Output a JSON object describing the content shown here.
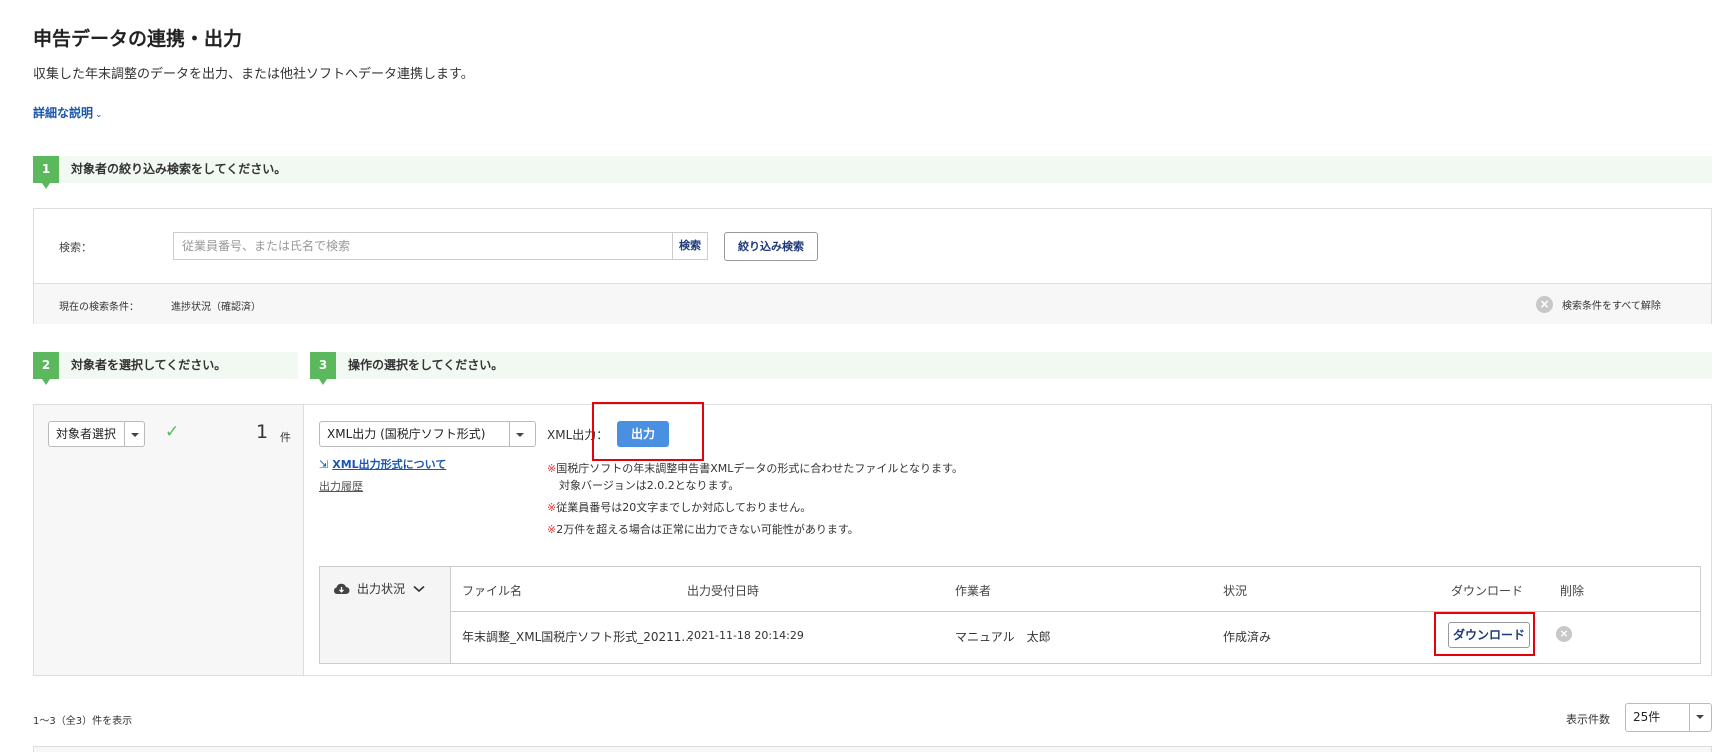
{
  "header": {
    "title": "申告データの連携・出力",
    "description": "収集した年末調整のデータを出力、または他社ソフトへデータ連携します。",
    "detail_link": "詳細な説明",
    "detail_chevron": "⌄"
  },
  "step1": {
    "number": "1",
    "label": "対象者の絞り込み検索をしてください。",
    "search_label": "検索：",
    "search_placeholder": "従業員番号、または氏名で検索",
    "search_button": "検索",
    "filter_button": "絞り込み検索",
    "current_condition_label": "現在の検索条件：",
    "current_condition_value": "進捗状況（確認済）",
    "clear_all": "検索条件をすべて解除"
  },
  "step2": {
    "number": "2",
    "label": "対象者を選択してください。",
    "select_dropdown": "対象者選択",
    "check_mark": "✓",
    "count": "1",
    "count_unit": "件"
  },
  "step3": {
    "number": "3",
    "label": "操作の選択をしてください。",
    "format_dropdown": "XML出力 (国税庁ソフト形式)",
    "output_label": "XML出力：",
    "output_button": "出力",
    "format_link_icon": "⇲",
    "format_link": "XML出力形式について",
    "history_link": "出力履歴",
    "notes": [
      {
        "mark": "※",
        "text": "国税庁ソフトの年末調整申告書XMLデータの形式に合わせたファイルとなります。"
      },
      {
        "mark": "",
        "text": "対象バージョンは2.0.2となります。"
      },
      {
        "mark": "※",
        "text": "従業員番号は20文字までしか対応しておりません。"
      },
      {
        "mark": "※",
        "text": "2万件を超える場合は正常に出力できない可能性があります。"
      }
    ]
  },
  "output_table": {
    "status_toggle": "出力状況",
    "columns": {
      "filename": "ファイル名",
      "received": "出力受付日時",
      "operator": "作業者",
      "status": "状況",
      "download": "ダウンロード",
      "delete": "削除"
    },
    "rows": [
      {
        "filename": "年末調整_XML国税庁ソフト形式_20211...",
        "received": "2021-11-18 20:14:29",
        "operator": "マニュアル　太郎",
        "status": "作成済み",
        "download_button": "ダウンロード"
      }
    ]
  },
  "footer": {
    "range_text": "1〜3（全3）件を表示",
    "page_size_label": "表示件数",
    "page_size_value": "25件"
  },
  "colors": {
    "step_green": "#5cb85c",
    "step_bg": "#f2f9f2",
    "primary_blue": "#4a90e2",
    "highlight_red": "#e8000b",
    "note_red": "#e53935"
  }
}
